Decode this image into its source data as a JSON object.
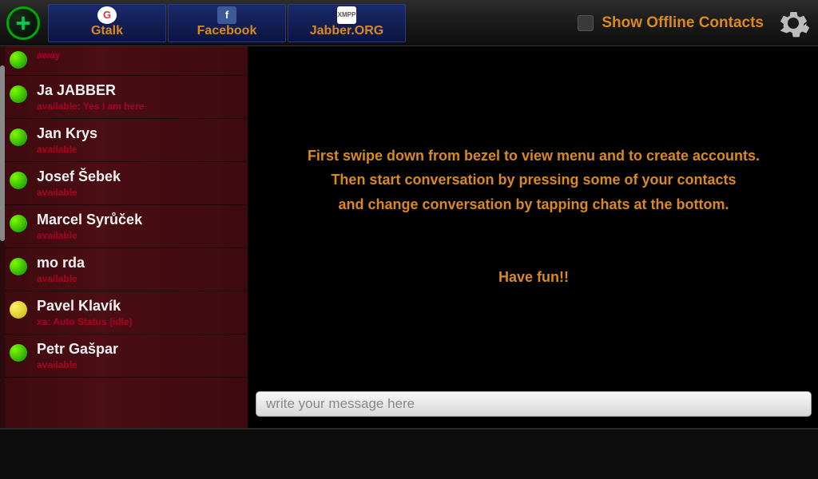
{
  "header": {
    "tabs": [
      {
        "label": "Gtalk",
        "icon": "gtalk"
      },
      {
        "label": "Facebook",
        "icon": "facebook"
      },
      {
        "label": "Jabber.ORG",
        "icon": "xmpp"
      }
    ],
    "show_offline_label": "Show Offline Contacts",
    "show_offline_checked": false
  },
  "contacts": [
    {
      "name": "",
      "status": "away",
      "presence": "green",
      "first": true
    },
    {
      "name": "Ja JABBER",
      "status": "available: Yes I am here",
      "presence": "green"
    },
    {
      "name": "Jan Krys",
      "status": "available",
      "presence": "green"
    },
    {
      "name": "Josef Šebek",
      "status": "available",
      "presence": "green"
    },
    {
      "name": "Marcel Syrůček",
      "status": "available",
      "presence": "green"
    },
    {
      "name": "mo rda",
      "status": "available",
      "presence": "green"
    },
    {
      "name": "Pavel Klavík",
      "status": "xa: Auto Status (idle)",
      "presence": "yellow"
    },
    {
      "name": "Petr Gašpar",
      "status": "available",
      "presence": "green"
    }
  ],
  "intro": {
    "line1": "First swipe down from bezel to view menu and to create accounts.",
    "line2": "Then start conversation by pressing some of your contacts",
    "line3": "and change conversation by tapping chats at the bottom.",
    "line4": "Have fun!!"
  },
  "input": {
    "placeholder": "write your message here"
  }
}
